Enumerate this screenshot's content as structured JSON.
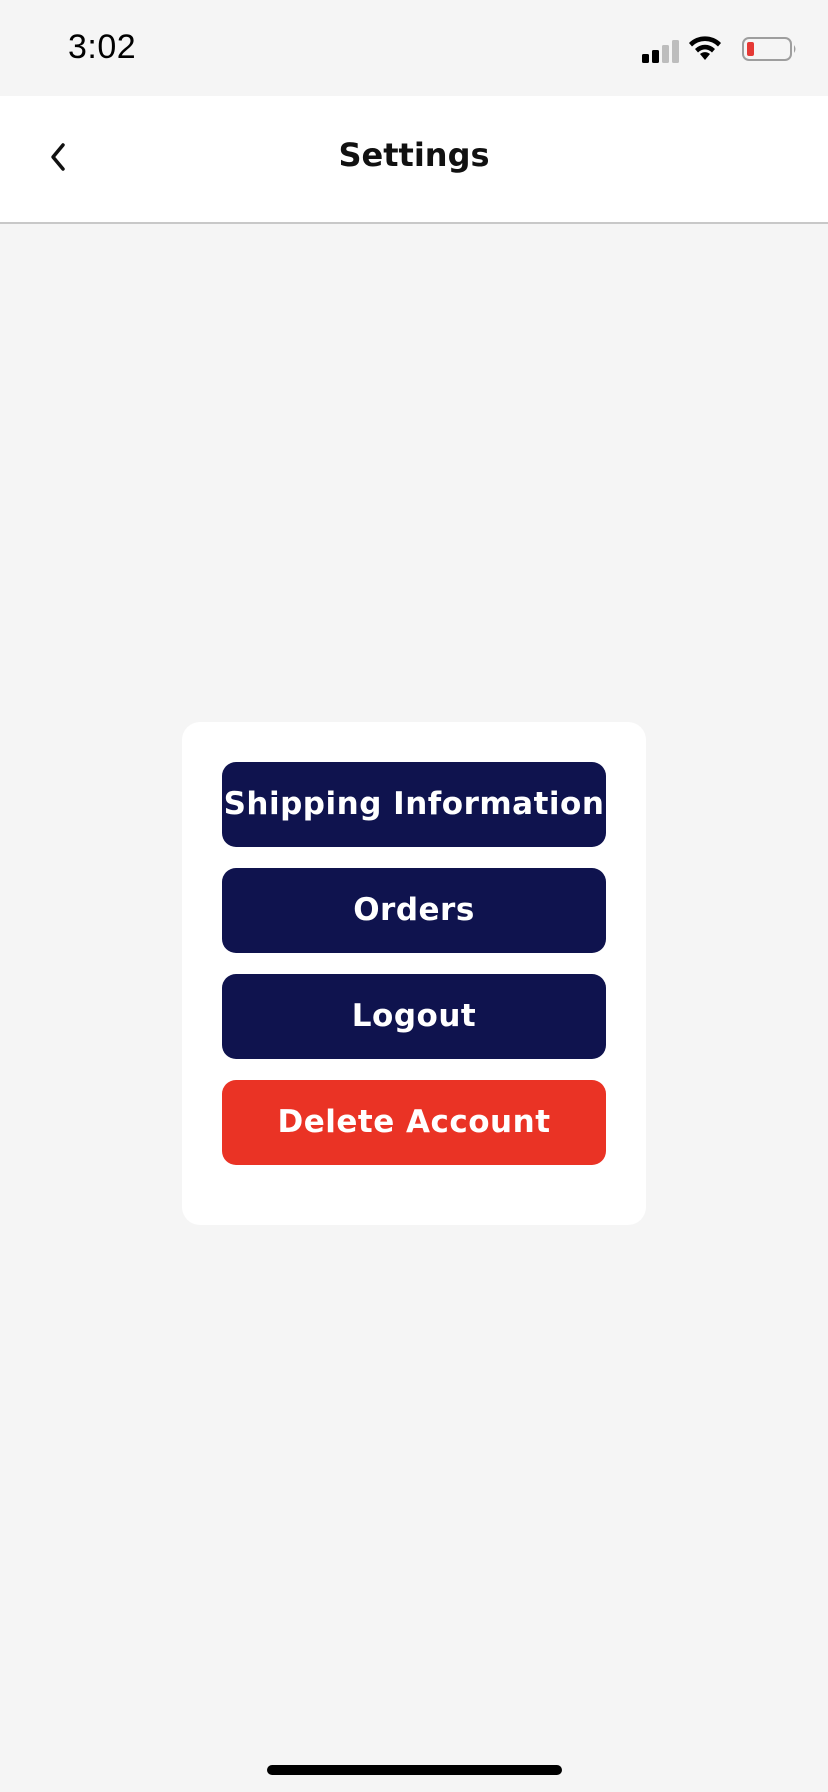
{
  "status_bar": {
    "time": "3:02"
  },
  "header": {
    "title": "Settings"
  },
  "menu": {
    "buttons": [
      {
        "label": "Shipping Information",
        "color": "#0f134e"
      },
      {
        "label": "Orders",
        "color": "#0f134e"
      },
      {
        "label": "Logout",
        "color": "#0f134e"
      },
      {
        "label": "Delete Account",
        "color": "#ea3325"
      }
    ]
  },
  "icons": {
    "back": "chevron-left-icon",
    "signal": "cellular-signal-icon",
    "wifi": "wifi-icon",
    "battery": "battery-low-icon"
  },
  "colors": {
    "navy": "#0f134e",
    "danger": "#ea3325",
    "background": "#f5f5f5",
    "battery_low": "#e53935"
  }
}
